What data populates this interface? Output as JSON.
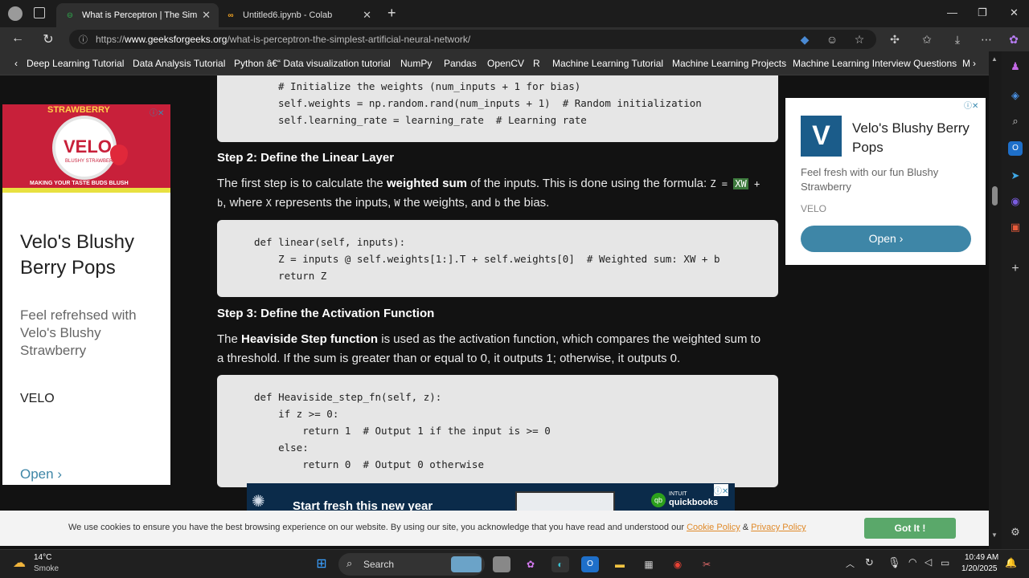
{
  "tabs": [
    {
      "title": "What is Perceptron | The Simplest",
      "favicon": "GfG",
      "active": true
    },
    {
      "title": "Untitled6.ipynb - Colab",
      "favicon": "CO",
      "active": false
    }
  ],
  "address": {
    "prefix": "https://",
    "host": "www.geeksforgeeks.org",
    "path": "/what-is-perceptron-the-simplest-artificial-neural-network/"
  },
  "bookmarks": [
    "Deep Learning Tutorial",
    "Data Analysis Tutorial",
    "Python â€“ Data visualization tutorial",
    "NumPy",
    "Pandas",
    "OpenCV",
    "R",
    "Machine Learning Tutorial",
    "Machine Learning Projects",
    "Machine Learning Interview Questions",
    "M"
  ],
  "code1": [
    "# Initialize the weights (num_inputs + 1 for bias)",
    "self.weights = np.random.rand(num_inputs + 1)  # Random initialization",
    "self.learning_rate = learning_rate  # Learning rate"
  ],
  "step2": {
    "heading": "Step 2: Define the Linear Layer",
    "p_a": "The first step is to calculate the ",
    "p_bold": "weighted sum",
    "p_b": " of the inputs. This is done using the formula: ",
    "f1": "Z = ",
    "f_hl": "XW",
    "f2": " +",
    "p_line2_b": "b",
    "p_line2_c": ", where ",
    "p_x": "X",
    "p_line2_d": " represents the inputs, ",
    "p_w": "W",
    "p_line2_e": " the weights, and ",
    "p_b2": "b",
    "p_line2_f": " the bias."
  },
  "code2": [
    "def linear(self, inputs):",
    "    Z = inputs @ self.weights[1:].T + self.weights[0]  # Weighted sum: XW + b",
    "    return Z"
  ],
  "step3": {
    "heading": "Step 3: Define the Activation Function",
    "p_a": "The ",
    "p_bold": "Heaviside Step function",
    "p_b": " is used as the activation function, which compares the weighted sum to",
    "p_line2": "a threshold. If the sum is greater than or equal to 0, it outputs 1; otherwise, it outputs 0."
  },
  "code3": [
    "def Heaviside_step_fn(self, z):",
    "    if z >= 0:",
    "        return 1  # Output 1 if the input is >= 0",
    "    else:",
    "        return 0  # Output 0 otherwise"
  ],
  "leftad": {
    "brand_top": "STRAWBERRY",
    "brand": "VELO",
    "brand_sub": "BLUSHY STRAWBERRY",
    "tagline": "MAKING YOUR TASTE BUDS BLUSH",
    "title": "Velo's Blushy Berry Pops",
    "desc": "Feel refrehsed with Velo's Blushy Strawberry",
    "advertiser": "VELO",
    "cta": "Open"
  },
  "rightad": {
    "title": "Velo's Blushy Berry Pops",
    "desc": "Feel fresh with our fun Blushy Strawberry",
    "advertiser": "VELO",
    "cta": "Open"
  },
  "bottomad": {
    "text": "Start fresh this new year",
    "brand_top": "INTUIT",
    "brand": "quickbooks"
  },
  "cookie": {
    "text": "We use cookies to ensure you have the best browsing experience on our website. By using our site, you acknowledge that you have read and understood our ",
    "link1": "Cookie Policy",
    "amp": " & ",
    "link2": "Privacy Policy",
    "button": "Got It !"
  },
  "taskbar": {
    "temp": "14°C",
    "weather": "Smoke",
    "search": "Search",
    "time": "10:49 AM",
    "date": "1/20/2025"
  },
  "colors": {
    "accent_green": "#4caf50",
    "ad_blue": "#3e86a7",
    "link": "#e08a2a",
    "got_it": "#5aa86a"
  }
}
